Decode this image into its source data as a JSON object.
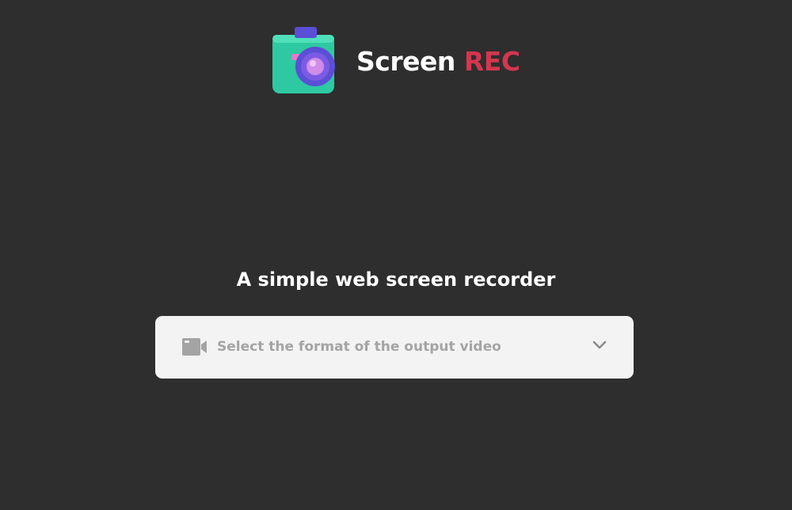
{
  "header": {
    "brand_primary": "Screen",
    "brand_accent": "REC",
    "logo_icon": "camera-icon",
    "accent_color": "#d3364f"
  },
  "main": {
    "tagline": "A simple web screen recorder",
    "format_select": {
      "placeholder": "Select the format of the output video",
      "icon": "video-camera-icon",
      "chevron": "chevron-down-icon"
    }
  },
  "colors": {
    "background": "#2e2e2e",
    "select_background": "#f3f3f3",
    "placeholder_text": "#a4a4a4"
  }
}
